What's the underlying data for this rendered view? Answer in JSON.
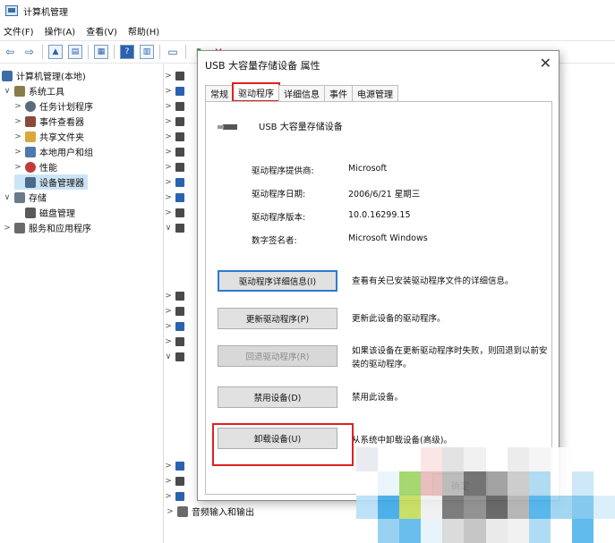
{
  "window": {
    "title": "计算机管理"
  },
  "menu": [
    "文件(F)",
    "操作(A)",
    "查看(V)",
    "帮助(H)"
  ],
  "tree": [
    {
      "label": "计算机管理(本地)",
      "arrow": "",
      "level": 0,
      "icon": "computer-icon",
      "color": "#3a6ea5"
    },
    {
      "label": "系统工具",
      "arrow": "∨",
      "level": 1,
      "icon": "tools-icon",
      "color": "#8a7b4a"
    },
    {
      "label": "任务计划程序",
      "arrow": ">",
      "level": 2,
      "icon": "clock-icon",
      "color": "#5a6a7a"
    },
    {
      "label": "事件查看器",
      "arrow": ">",
      "level": 2,
      "icon": "event-viewer-icon",
      "color": "#8a4a3a"
    },
    {
      "label": "共享文件夹",
      "arrow": ">",
      "level": 2,
      "icon": "shared-folder-icon",
      "color": "#d8a83a"
    },
    {
      "label": "本地用户和组",
      "arrow": ">",
      "level": 2,
      "icon": "users-icon",
      "color": "#4a7ab0"
    },
    {
      "label": "性能",
      "arrow": ">",
      "level": 2,
      "icon": "performance-icon",
      "color": "#c03a3a"
    },
    {
      "label": "设备管理器",
      "arrow": "",
      "level": 2,
      "icon": "device-manager-icon",
      "color": "#4a6a8a",
      "selected": true
    },
    {
      "label": "存储",
      "arrow": "∨",
      "level": 1,
      "icon": "storage-icon",
      "color": "#6a7a8a"
    },
    {
      "label": "磁盘管理",
      "arrow": "",
      "level": 2,
      "icon": "disk-icon",
      "color": "#5a5a5a"
    },
    {
      "label": "服务和应用程序",
      "arrow": ">",
      "level": 1,
      "icon": "services-icon",
      "color": "#6a6a6a"
    }
  ],
  "bottom_item": "音频输入和输出",
  "dialog": {
    "title": "USB 大容量存储设备 属性",
    "tabs": [
      "常规",
      "驱动程序",
      "详细信息",
      "事件",
      "电源管理"
    ],
    "device_name": "USB 大容量存储设备",
    "props": [
      {
        "k": "驱动程序提供商:",
        "v": "Microsoft"
      },
      {
        "k": "驱动程序日期:",
        "v": "2006/6/21 星期三"
      },
      {
        "k": "驱动程序版本:",
        "v": "10.0.16299.15"
      },
      {
        "k": "数字签名者:",
        "v": "Microsoft Windows"
      }
    ],
    "buttons": [
      {
        "label": "驱动程序详细信息(I)",
        "desc": "查看有关已安装驱动程序文件的详细信息。"
      },
      {
        "label": "更新驱动程序(P)",
        "desc": "更新此设备的驱动程序。"
      },
      {
        "label": "回退驱动程序(R)",
        "desc": "如果该设备在更新驱动程序时失败，则回退到以前安装的驱动程序。"
      },
      {
        "label": "禁用设备(D)",
        "desc": "禁用此设备。"
      },
      {
        "label": "卸载设备(U)",
        "desc": "从系统中卸载设备(高级)。"
      }
    ],
    "ok": "确定"
  },
  "colors": {
    "highlight": "#e02020",
    "selection": "#cce4f7",
    "focus": "#2d7bd1"
  }
}
